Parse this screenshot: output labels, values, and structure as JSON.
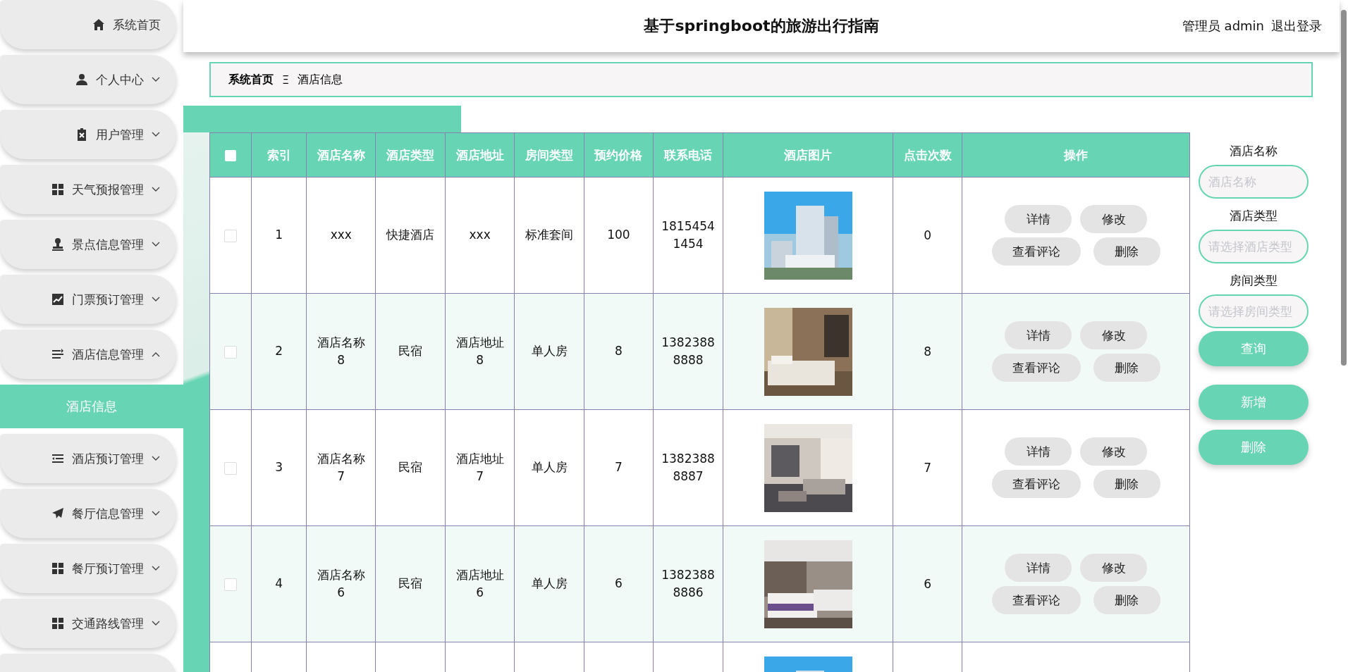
{
  "sidebar": {
    "items": [
      {
        "label": "系统首页",
        "kind": "home"
      },
      {
        "label": "个人中心",
        "kind": "user",
        "expanded": false
      },
      {
        "label": "用户管理",
        "kind": "clipboard",
        "expanded": false
      },
      {
        "label": "天气预报管理",
        "kind": "grid",
        "expanded": false
      },
      {
        "label": "景点信息管理",
        "kind": "stamp",
        "expanded": false
      },
      {
        "label": "门票预订管理",
        "kind": "chart",
        "expanded": false
      },
      {
        "label": "酒店信息管理",
        "kind": "list",
        "expanded": true,
        "children": [
          {
            "label": "酒店信息",
            "selected": true
          }
        ]
      },
      {
        "label": "酒店预订管理",
        "kind": "indent",
        "expanded": false
      },
      {
        "label": "餐厅信息管理",
        "kind": "plane",
        "expanded": false
      },
      {
        "label": "餐厅预订管理",
        "kind": "grid",
        "expanded": false
      },
      {
        "label": "交通路线管理",
        "kind": "grid",
        "expanded": false
      },
      {
        "kind": "cut"
      }
    ]
  },
  "header": {
    "title": "基于springboot的旅游出行指南",
    "user": "管理员 admin",
    "logout": "退出登录"
  },
  "breadcrumb": {
    "home": "系统首页",
    "separator": "Ξ",
    "current": "酒店信息"
  },
  "table": {
    "header_checkbox": {
      "checked": false
    },
    "columns": [
      "索引",
      "酒店名称",
      "酒店类型",
      "酒店地址",
      "房间类型",
      "预约价格",
      "联系电话",
      "酒店图片",
      "点击次数",
      "操作"
    ],
    "rows": [
      {
        "kind": "full",
        "checked": false,
        "cells": [
          "1",
          "xxx",
          "快捷酒店",
          "xxx",
          "标准套间",
          "100",
          "18154541454",
          "0"
        ],
        "image": {
          "kind": "picture"
        },
        "actions": [
          "详情",
          "修改",
          "查看评论",
          "删除"
        ]
      },
      {
        "kind": "full",
        "checked": false,
        "cells": [
          "2",
          "酒店名称8",
          "民宿",
          "酒店地址8",
          "单人房",
          "8",
          "13823888888",
          "8"
        ],
        "image": {
          "kind": "picture"
        },
        "actions": [
          "详情",
          "修改",
          "查看评论",
          "删除"
        ]
      },
      {
        "kind": "full",
        "checked": false,
        "cells": [
          "3",
          "酒店名称7",
          "民宿",
          "酒店地址7",
          "单人房",
          "7",
          "13823888887",
          "7"
        ],
        "image": {
          "kind": "picture"
        },
        "actions": [
          "详情",
          "修改",
          "查看评论",
          "删除"
        ]
      },
      {
        "kind": "full",
        "checked": false,
        "cells": [
          "4",
          "酒店名称6",
          "民宿",
          "酒店地址6",
          "单人房",
          "6",
          "13823888886",
          "6"
        ],
        "image": {
          "kind": "picture"
        },
        "actions": [
          "详情",
          "修改",
          "查看评论",
          "删除"
        ]
      },
      {
        "kind": "cut",
        "image": {
          "kind": "picture"
        }
      }
    ]
  },
  "search": {
    "fields": [
      {
        "label": "酒店名称",
        "placeholder": "酒店名称"
      },
      {
        "label": "酒店类型",
        "placeholder": "请选择酒店类型"
      },
      {
        "label": "房间类型",
        "placeholder": "请选择房间类型"
      }
    ],
    "query_button": "查询",
    "add_button": "新增",
    "delete_button": "删除"
  }
}
